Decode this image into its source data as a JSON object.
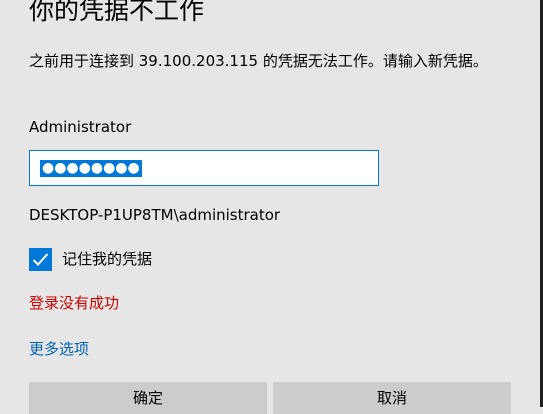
{
  "dialog": {
    "title": "你的凭据不工作",
    "description": "之前用于连接到 39.100.203.115 的凭据无法工作。请输入新凭据。",
    "username": "Administrator",
    "password_mask": "●●●●●●●●",
    "domain_user": "DESKTOP-P1UP8TM\\administrator",
    "remember_label": "记住我的凭据",
    "remember_checked": true,
    "error_text": "登录没有成功",
    "more_options": "更多选项",
    "ok_label": "确定",
    "cancel_label": "取消"
  },
  "colors": {
    "accent": "#0078d7",
    "error": "#c50500",
    "link": "#0063b1",
    "background": "#e6e6e6",
    "button": "#cccccc"
  }
}
